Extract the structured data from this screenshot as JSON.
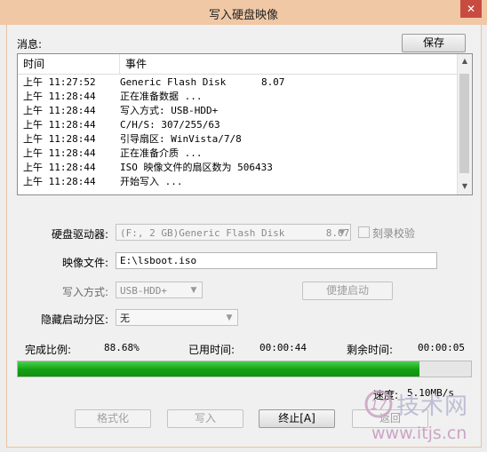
{
  "window": {
    "title": "写入硬盘映像",
    "close_glyph": "✕"
  },
  "messages": {
    "label": "消息:",
    "save_label": "保存",
    "columns": [
      "时间",
      "事件"
    ],
    "rows": [
      {
        "time": "上午 11:27:52",
        "event": "Generic Flash Disk      8.07"
      },
      {
        "time": "上午 11:28:44",
        "event": "正在准备数据 ..."
      },
      {
        "time": "上午 11:28:44",
        "event": "写入方式: USB-HDD+"
      },
      {
        "time": "上午 11:28:44",
        "event": "C/H/S: 307/255/63"
      },
      {
        "time": "上午 11:28:44",
        "event": "引导扇区: WinVista/7/8"
      },
      {
        "time": "上午 11:28:44",
        "event": "正在准备介质 ..."
      },
      {
        "time": "上午 11:28:44",
        "event": "ISO 映像文件的扇区数为 506433"
      },
      {
        "time": "上午 11:28:44",
        "event": "开始写入 ..."
      }
    ]
  },
  "form": {
    "drive_label": "硬盘驱动器:",
    "drive_value": "(F:, 2 GB)Generic Flash Disk       8.07",
    "verify_label": "刻录校验",
    "image_label": "映像文件:",
    "image_value": "E:\\lsboot.iso",
    "write_mode_label": "写入方式:",
    "write_mode_value": "USB-HDD+",
    "quick_boot_label": "便捷启动",
    "hidden_partition_label": "隐藏启动分区:",
    "hidden_partition_value": "无"
  },
  "status": {
    "complete_label": "完成比例:",
    "complete_value": "88.68%",
    "progress_fraction": 0.8868,
    "elapsed_label": "已用时间:",
    "elapsed_value": "00:00:44",
    "remaining_label": "剩余时间:",
    "remaining_value": "00:00:05",
    "speed_label": "速度:",
    "speed_value": "5.10MB/s"
  },
  "buttons": {
    "format": "格式化",
    "write": "写入",
    "stop": "终止[A]",
    "back": "返回"
  },
  "watermark": {
    "brand": "技术网",
    "url": "www.itjs.cn"
  },
  "colors": {
    "titlebar": "#f0c8a6",
    "progress_fill": "#13a013",
    "close": "#c74b41"
  }
}
